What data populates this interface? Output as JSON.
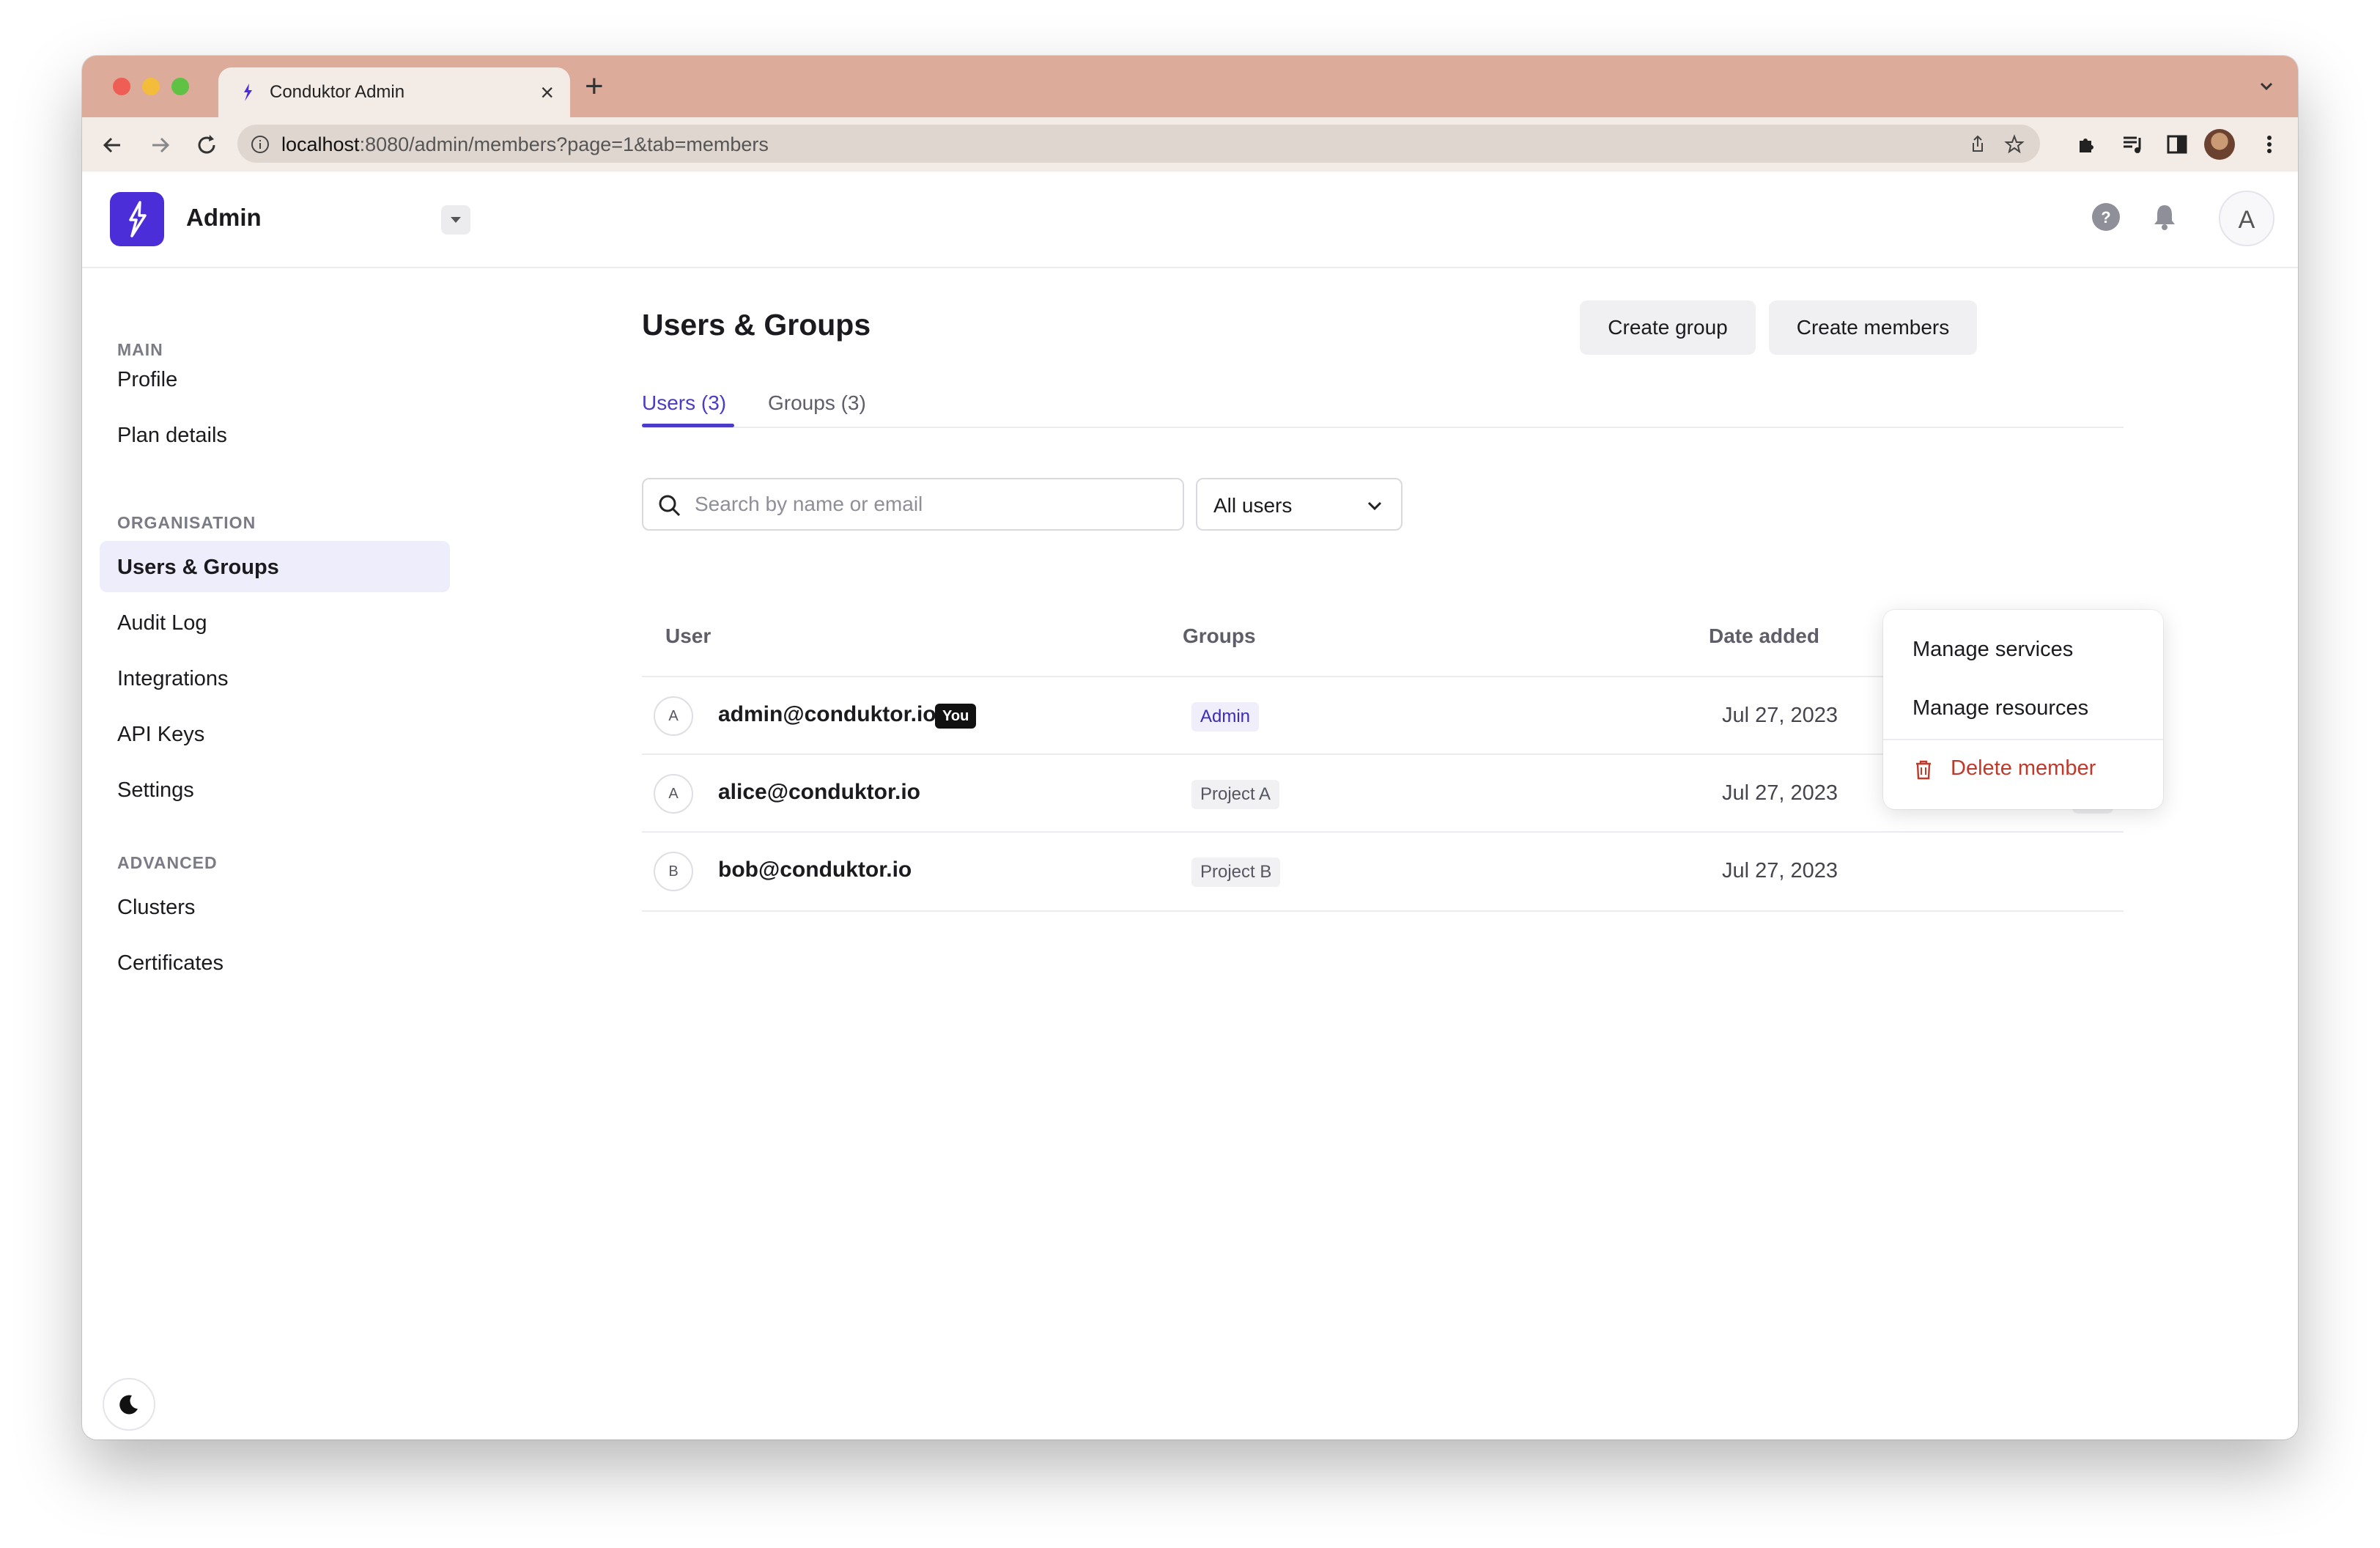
{
  "browser": {
    "tab_title": "Conduktor Admin",
    "url_host": "localhost",
    "url_rest": ":8080/admin/members?page=1&tab=members",
    "icons": [
      "back-icon",
      "forward-icon",
      "reload-icon",
      "info-icon",
      "share-icon",
      "star-icon",
      "extensions-icon",
      "media-icon",
      "sidebar-icon",
      "more-vertical-icon"
    ]
  },
  "header": {
    "app_name": "Admin",
    "avatar_letter": "A"
  },
  "sidebar": {
    "sections": [
      {
        "title": "MAIN",
        "items": [
          "Profile",
          "Plan details"
        ]
      },
      {
        "title": "ORGANISATION",
        "items": [
          "Users & Groups",
          "Audit Log",
          "Integrations",
          "API Keys",
          "Settings"
        ]
      },
      {
        "title": "ADVANCED",
        "items": [
          "Clusters",
          "Certificates"
        ]
      }
    ],
    "active_item": "Users & Groups"
  },
  "main": {
    "title": "Users & Groups",
    "actions": {
      "create_group": "Create group",
      "create_members": "Create members"
    },
    "tabs": [
      {
        "label": "Users (3)",
        "active": true
      },
      {
        "label": "Groups (3)",
        "active": false
      }
    ],
    "search": {
      "placeholder": "Search by name or email",
      "value": ""
    },
    "filter": {
      "selected": "All users"
    },
    "table": {
      "columns": [
        "User",
        "Groups",
        "Date added"
      ],
      "rows": [
        {
          "avatar": "A",
          "email": "admin@conduktor.io",
          "badge": "You",
          "group": "Admin",
          "date": "Jul 27, 2023"
        },
        {
          "avatar": "A",
          "email": "alice@conduktor.io",
          "group": "Project A",
          "date": "Jul 27, 2023"
        },
        {
          "avatar": "B",
          "email": "bob@conduktor.io",
          "group": "Project B",
          "date": "Jul 27, 2023"
        }
      ]
    },
    "row_menu": {
      "items": [
        "Manage services",
        "Manage resources"
      ],
      "danger_item": "Delete member"
    }
  },
  "colors": {
    "accent": "#4a3cc8",
    "logo": "#4c2ed8",
    "danger": "#c0392b",
    "tab_strip": "#dcab9a"
  }
}
